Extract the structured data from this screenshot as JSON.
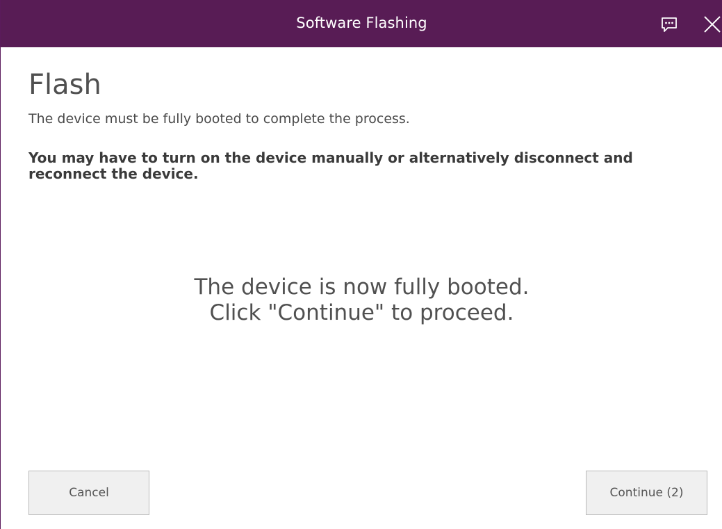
{
  "window": {
    "title": "Software Flashing",
    "titlebar_color": "#581c55"
  },
  "titlebar": {
    "feedback_icon": "feedback-icon",
    "close_icon": "close-icon"
  },
  "page": {
    "heading": "Flash",
    "subtext": "The device must be fully booted to complete the process.",
    "warning": "You may have to turn on the device manually or alternatively disconnect and reconnect the device.",
    "status_line1": "The device is now fully booted.",
    "status_line2": "Click \"Continue\" to proceed."
  },
  "buttons": {
    "cancel_label": "Cancel",
    "continue_label": "Continue (2)"
  }
}
